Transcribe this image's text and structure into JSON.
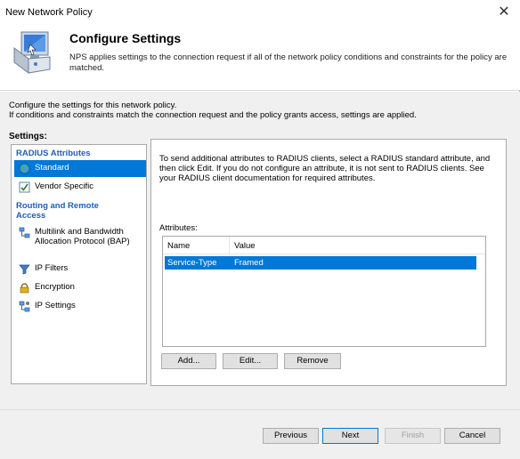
{
  "window": {
    "title": "New Network Policy",
    "close_glyph": "✕"
  },
  "header": {
    "title": "Configure Settings",
    "description": "NPS applies settings to the connection request if all of the network policy conditions and constraints for the policy are matched.",
    "icon": "network-computer-icon"
  },
  "intro": {
    "line1": "Configure the settings for this network policy.",
    "line2": "If conditions and constraints match the connection request and the policy grants access, settings are applied."
  },
  "settings_label": "Settings:",
  "nav": {
    "section_radius": "RADIUS Attributes",
    "items_radius": [
      {
        "label": "Standard",
        "icon": "globe-icon",
        "selected": true
      },
      {
        "label": "Vendor Specific",
        "icon": "checkbox-doc-icon",
        "selected": false
      }
    ],
    "section_routing": "Routing and Remote Access",
    "items_routing": [
      {
        "label": "Multilink and Bandwidth Allocation Protocol (BAP)",
        "icon": "network-link-icon"
      },
      {
        "label": "IP Filters",
        "icon": "funnel-icon"
      },
      {
        "label": "Encryption",
        "icon": "lock-icon"
      },
      {
        "label": "IP Settings",
        "icon": "network-settings-icon"
      }
    ]
  },
  "content": {
    "info": "To send additional attributes to RADIUS clients, select a RADIUS standard attribute, and then click Edit. If you do not configure an attribute, it is not sent to RADIUS clients. See your RADIUS client documentation for required attributes.",
    "attributes_label": "Attributes:",
    "columns": [
      "Name",
      "Value"
    ],
    "rows": [
      {
        "name": "Service-Type",
        "value": "Framed",
        "selected": true
      }
    ],
    "buttons": {
      "add": "Add...",
      "edit": "Edit...",
      "remove": "Remove"
    }
  },
  "footer": {
    "previous": "Previous",
    "next": "Next",
    "finish": "Finish",
    "cancel": "Cancel"
  },
  "colors": {
    "selection": "#0078d7",
    "section_heading": "#1f5fb4"
  }
}
